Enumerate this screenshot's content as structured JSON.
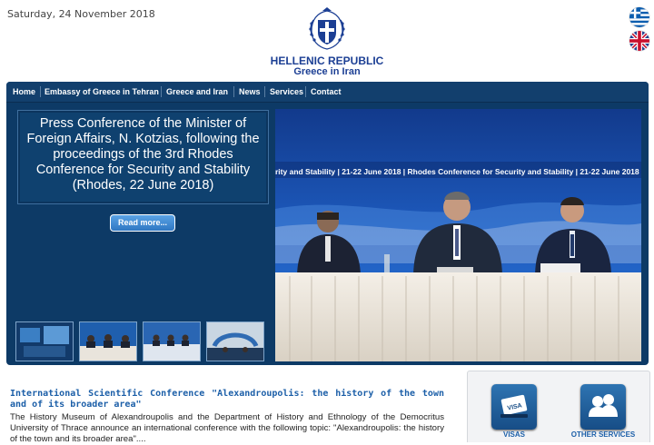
{
  "header": {
    "date": "Saturday, 24 November 2018",
    "line1": "HELLENIC REPUBLIC",
    "line2": "Greece in Iran"
  },
  "languages": [
    {
      "flag": "greek-flag-icon"
    },
    {
      "flag": "uk-flag-icon"
    }
  ],
  "nav": {
    "items": [
      {
        "label": "Home"
      },
      {
        "label": "Embassy of Greece in Tehran"
      },
      {
        "label": "Greece and Iran"
      },
      {
        "label": "News"
      },
      {
        "label": "Services"
      },
      {
        "label": "Contact"
      }
    ]
  },
  "featured": {
    "title": "Press Conference of the Minister of Foreign Affairs, N. Kotzias, following the proceedings of the 3rd Rhodes Conference for Security and Stability (Rhodes, 22 June 2018)",
    "button": "Read more...",
    "photo_banner": "rity and Stability | 21-22 June 2018 | Rhodes Conference for Security and Stability | 21-22 June 2018 | Rhode"
  },
  "news": {
    "title": "International Scientific Conference \"Alexandroupolis: the history of the town and of its broader area\"",
    "body": "The History Museum of Alexandroupolis and the Department of History and Ethnology of the Democritus University of Thrace announce an international conference with the following topic: \"Alexandroupolis: the history of the town and its broader area\"...."
  },
  "services": {
    "visas": "VISAS",
    "other": "OTHER SERVICES"
  },
  "colors": {
    "brand": "#1c3f94",
    "panel": "#0d3a66",
    "link": "#1c5fa8"
  }
}
